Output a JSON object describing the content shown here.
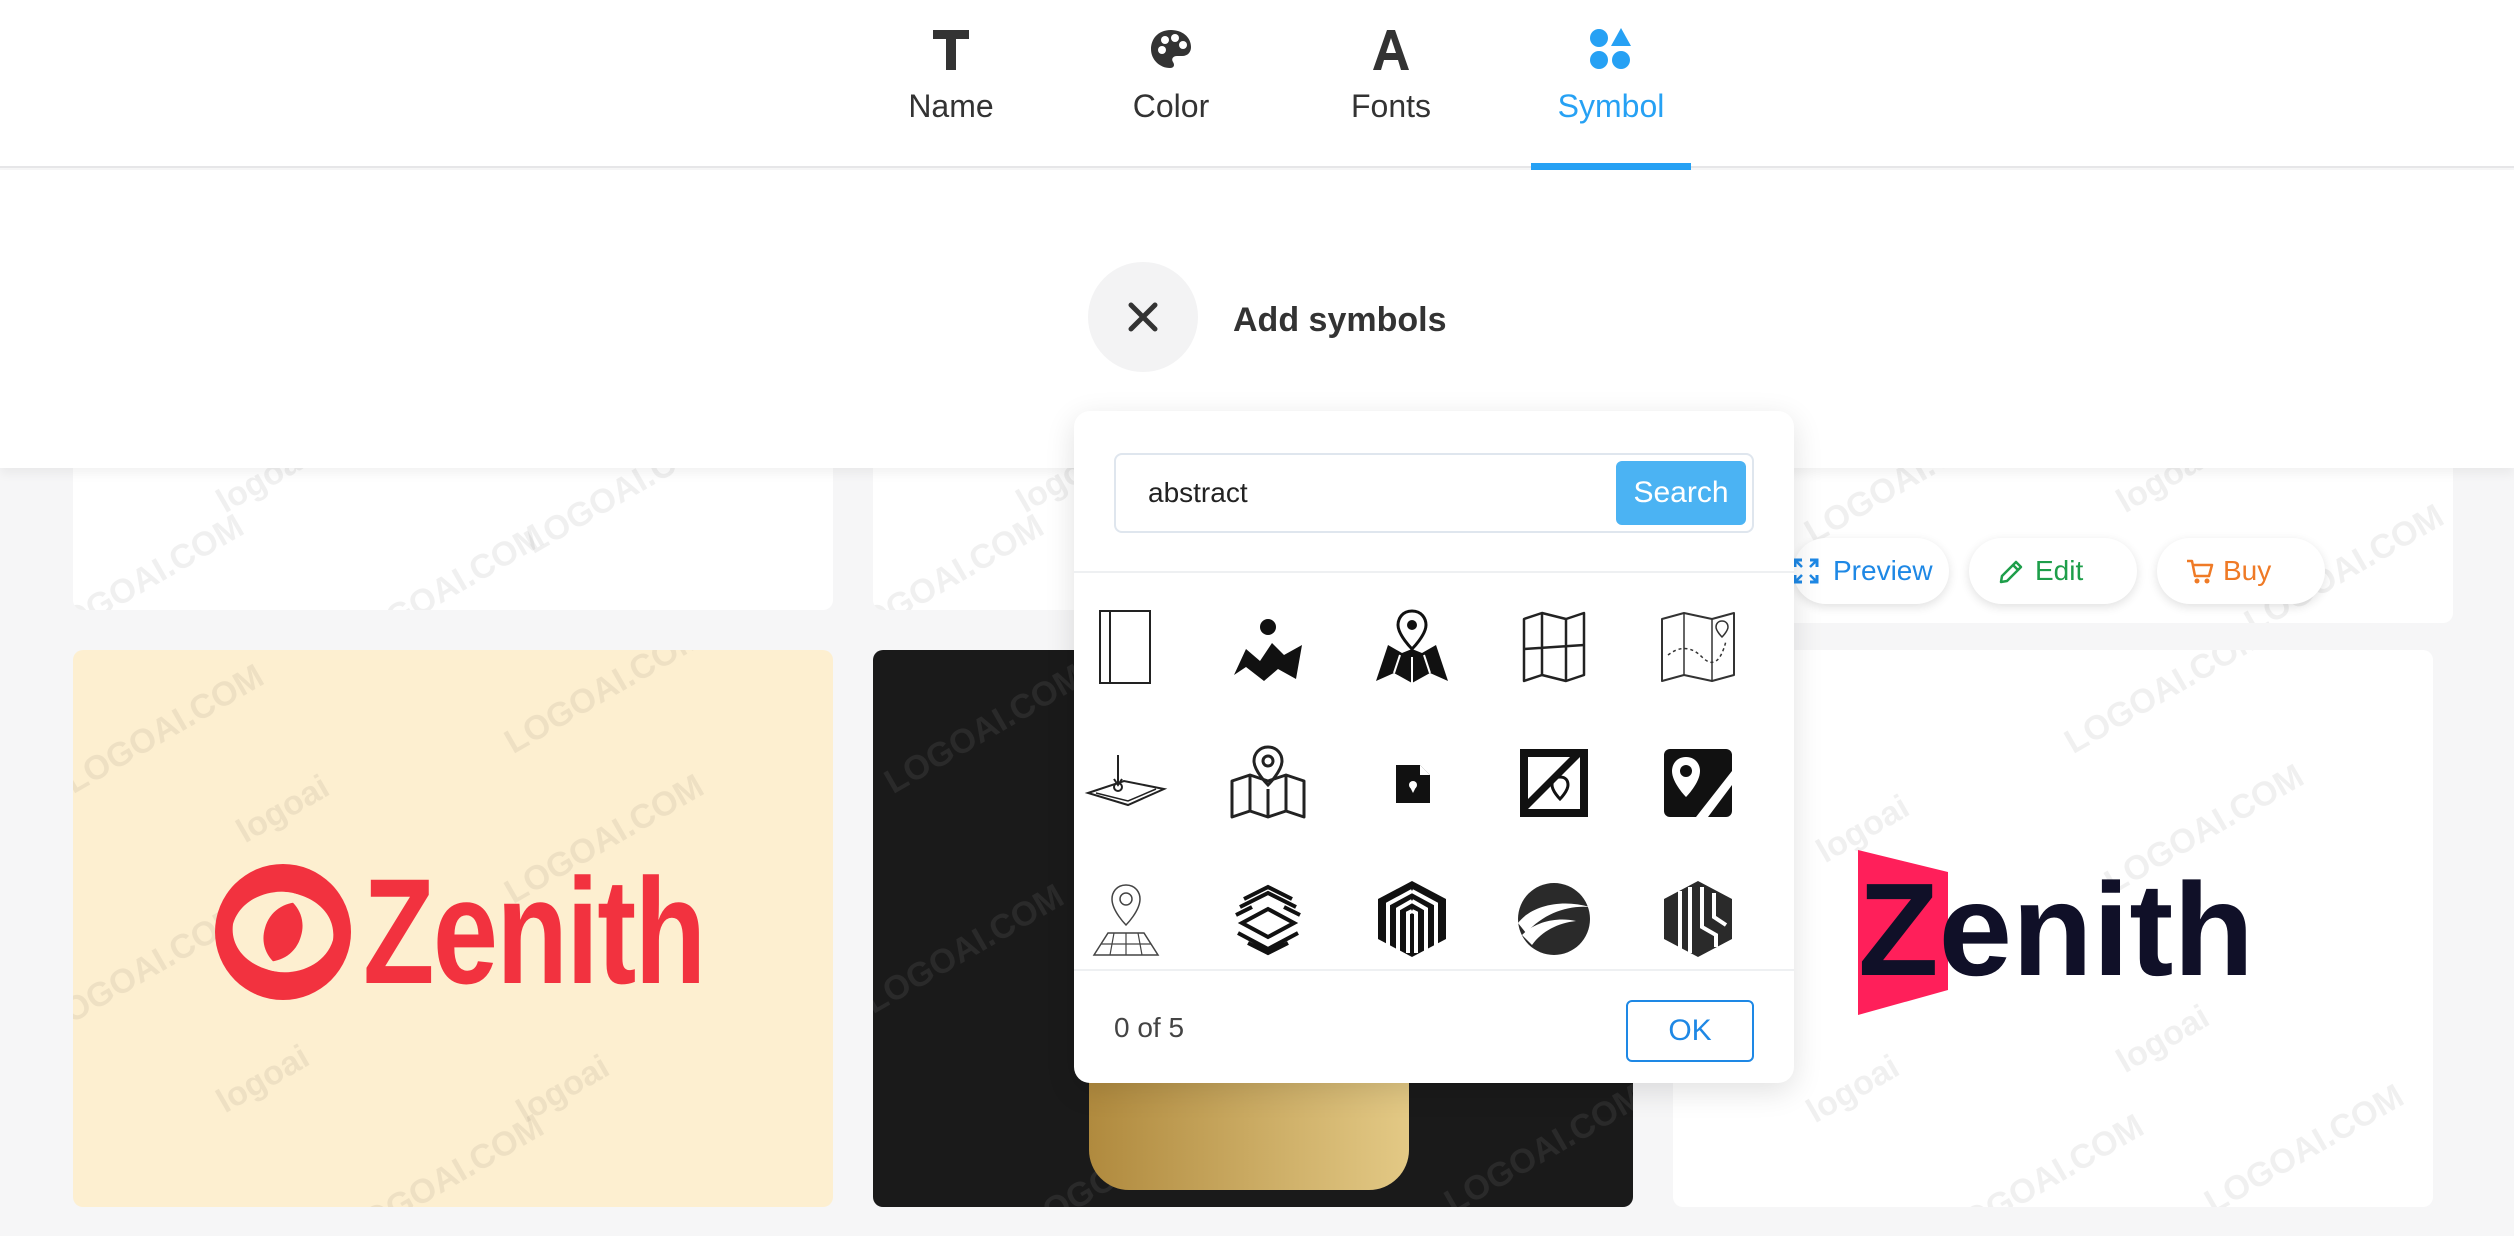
{
  "tabs": [
    {
      "label": "Name",
      "icon": "text-t-icon",
      "active": false
    },
    {
      "label": "Color",
      "icon": "palette-icon",
      "active": false
    },
    {
      "label": "Fonts",
      "icon": "font-a-icon",
      "active": false
    },
    {
      "label": "Symbol",
      "icon": "shapes-icon",
      "active": true
    }
  ],
  "panel": {
    "title": "Add symbols"
  },
  "search": {
    "value": "abstract",
    "button_label": "Search"
  },
  "symbols": [
    "door-panel-icon",
    "map-pin-terrain-icon",
    "map-pin-fold-icon",
    "folded-map-icon",
    "route-map-icon",
    "pin-plane-icon",
    "map-location-icon",
    "file-pin-icon",
    "framed-map-icon",
    "slash-pin-icon",
    "map-grid-pin-icon",
    "stripe-cube-icon",
    "hexagon-lines-icon",
    "swoosh-circle-icon",
    "stripe-hexagon-icon"
  ],
  "footer": {
    "count_text": "0 of 5",
    "ok_label": "OK"
  },
  "card_actions": {
    "preview_label": "Preview",
    "edit_label": "Edit",
    "buy_label": "Buy"
  },
  "logos": {
    "card1_word": "Zenith",
    "card3_word": "Zenith"
  },
  "watermark": {
    "brand": "logoai",
    "domain": "LOGOAI.COM"
  },
  "colors": {
    "accent": "#26a1f4",
    "logo_red": "#f2323f",
    "logo_pink": "#ff1f5a",
    "preview_blue": "#1e88e5",
    "edit_green": "#1e9e4a",
    "buy_orange": "#ef7a26"
  }
}
